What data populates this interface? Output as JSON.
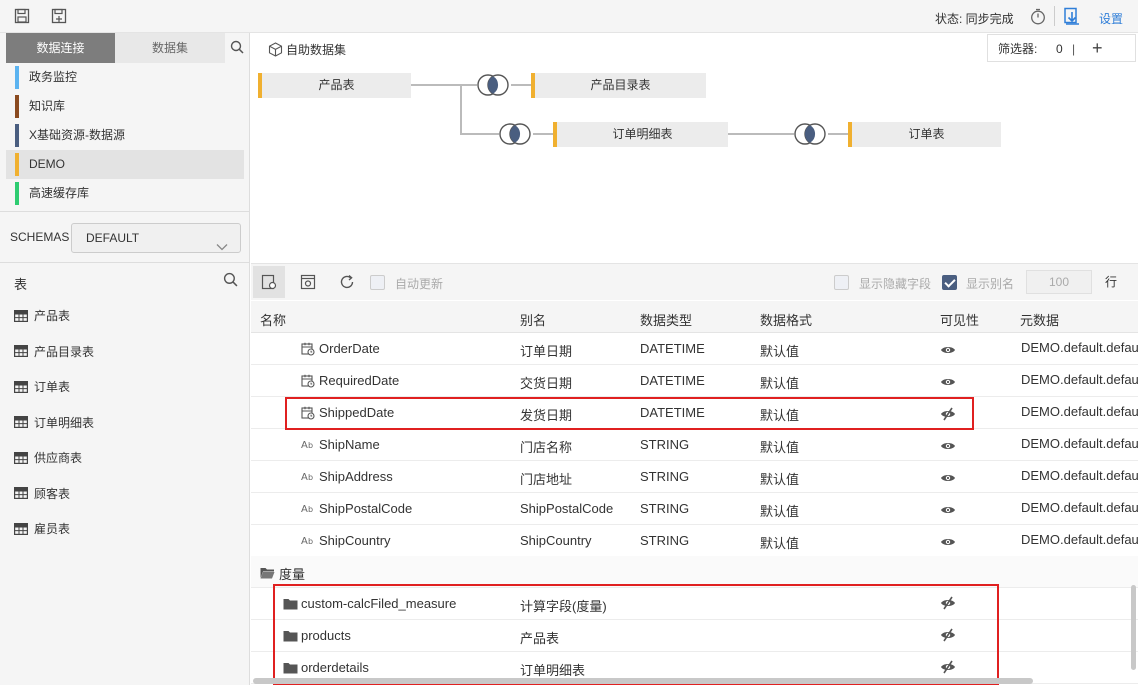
{
  "toolbar": {
    "save_icon": "save-icon",
    "save_as_icon": "save-as-icon",
    "status": "状态: 同步完成",
    "timer_icon": "timer-icon",
    "download_icon": "download-icon",
    "settings": "设置"
  },
  "left_panel": {
    "tabs": [
      {
        "label": "数据连接",
        "active": true
      },
      {
        "label": "数据集",
        "active": false
      }
    ],
    "connections": [
      {
        "label": "政务监控",
        "color": "#5bb3f0"
      },
      {
        "label": "知识库",
        "color": "#8a4a20"
      },
      {
        "label": "X基础资源-数据源",
        "color": "#4a5e80"
      },
      {
        "label": "DEMO",
        "color": "#f0b030",
        "selected": true
      },
      {
        "label": "高速缓存库",
        "color": "#2ecc71"
      }
    ],
    "schemas_label": "SCHEMAS",
    "schema_value": "DEFAULT",
    "tables_label": "表",
    "tables": [
      "产品表",
      "产品目录表",
      "订单表",
      "订单明细表",
      "供应商表",
      "顾客表",
      "雇员表"
    ]
  },
  "diagram": {
    "title": "自助数据集",
    "filter_label": "筛选器:",
    "filter_count": "0",
    "filter_sep": "|",
    "filter_add": "+",
    "nodes": [
      {
        "label": "产品表"
      },
      {
        "label": "产品目录表"
      },
      {
        "label": "订单明细表"
      },
      {
        "label": "订单表"
      }
    ]
  },
  "grid_toolbar": {
    "auto_update": "自动更新",
    "show_hidden": "显示隐藏字段",
    "show_alias": "显示别名",
    "show_alias_checked": true,
    "rows_value": "100",
    "rows_unit": "行"
  },
  "grid": {
    "headers": {
      "name": "名称",
      "alias": "别名",
      "type": "数据类型",
      "format": "数据格式",
      "visible": "可见性",
      "meta": "元数据"
    },
    "rows": [
      {
        "icon": "date-field-icon",
        "name": "OrderDate",
        "alias": "订单日期",
        "type": "DATETIME",
        "format": "默认值",
        "eye": "eye-icon",
        "meta": "DEMO.default.default"
      },
      {
        "icon": "date-field-icon",
        "name": "RequiredDate",
        "alias": "交货日期",
        "type": "DATETIME",
        "format": "默认值",
        "eye": "eye-icon",
        "meta": "DEMO.default.default"
      },
      {
        "icon": "date-field-icon",
        "name": "ShippedDate",
        "alias": "发货日期",
        "type": "DATETIME",
        "format": "默认值",
        "eye": "eye-hidden-icon",
        "meta": "DEMO.default.default"
      },
      {
        "icon": "text-field-icon",
        "name": "ShipName",
        "alias": "门店名称",
        "type": "STRING",
        "format": "默认值",
        "eye": "eye-icon",
        "meta": "DEMO.default.default"
      },
      {
        "icon": "text-field-icon",
        "name": "ShipAddress",
        "alias": "门店地址",
        "type": "STRING",
        "format": "默认值",
        "eye": "eye-icon",
        "meta": "DEMO.default.default"
      },
      {
        "icon": "text-field-icon",
        "name": "ShipPostalCode",
        "alias": "ShipPostalCode",
        "type": "STRING",
        "format": "默认值",
        "eye": "eye-icon",
        "meta": "DEMO.default.default"
      },
      {
        "icon": "text-field-icon",
        "name": "ShipCountry",
        "alias": "ShipCountry",
        "type": "STRING",
        "format": "默认值",
        "eye": "eye-icon",
        "meta": "DEMO.default.default"
      }
    ],
    "group_label": "度量",
    "measures": [
      {
        "name": "custom-calcFiled_measure",
        "alias": "计算字段(度量)",
        "eye": "eye-hidden-icon"
      },
      {
        "name": "products",
        "alias": "产品表",
        "eye": "eye-hidden-icon"
      },
      {
        "name": "orderdetails",
        "alias": "订单明细表",
        "eye": "eye-hidden-icon"
      }
    ]
  },
  "colors": {
    "accent": "#2f7ed8",
    "highlight": "#e02020",
    "node_edge": "#f0b030"
  }
}
